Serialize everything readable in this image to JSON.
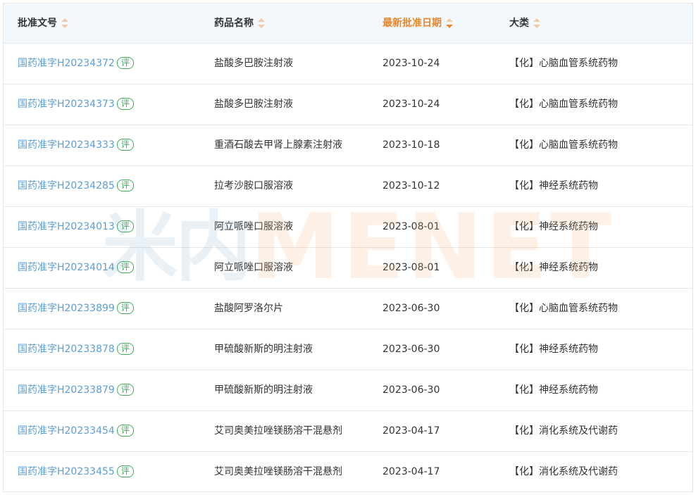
{
  "columns": [
    {
      "label": "批准文号",
      "sorted": false
    },
    {
      "label": "药品名称",
      "sorted": false
    },
    {
      "label": "最新批准日期",
      "sorted": true
    },
    {
      "label": "大类",
      "sorted": false
    }
  ],
  "badge_label": "评",
  "rows": [
    {
      "approval_no": "国药准字H20234372",
      "drug_name": "盐酸多巴胺注射液",
      "date": "2023-10-24",
      "category": "【化】心脑血管系统药物"
    },
    {
      "approval_no": "国药准字H20234373",
      "drug_name": "盐酸多巴胺注射液",
      "date": "2023-10-24",
      "category": "【化】心脑血管系统药物"
    },
    {
      "approval_no": "国药准字H20234333",
      "drug_name": "重酒石酸去甲肾上腺素注射液",
      "date": "2023-10-18",
      "category": "【化】心脑血管系统药物"
    },
    {
      "approval_no": "国药准字H20234285",
      "drug_name": "拉考沙胺口服溶液",
      "date": "2023-10-12",
      "category": "【化】神经系统药物"
    },
    {
      "approval_no": "国药准字H20234013",
      "drug_name": "阿立哌唑口服溶液",
      "date": "2023-08-01",
      "category": "【化】神经系统药物"
    },
    {
      "approval_no": "国药准字H20234014",
      "drug_name": "阿立哌唑口服溶液",
      "date": "2023-08-01",
      "category": "【化】神经系统药物"
    },
    {
      "approval_no": "国药准字H20233899",
      "drug_name": "盐酸阿罗洛尔片",
      "date": "2023-06-30",
      "category": "【化】心脑血管系统药物"
    },
    {
      "approval_no": "国药准字H20233878",
      "drug_name": "甲硫酸新斯的明注射液",
      "date": "2023-06-30",
      "category": "【化】神经系统药物"
    },
    {
      "approval_no": "国药准字H20233879",
      "drug_name": "甲硫酸新斯的明注射液",
      "date": "2023-06-30",
      "category": "【化】神经系统药物"
    },
    {
      "approval_no": "国药准字H20233454",
      "drug_name": "艾司奥美拉唑镁肠溶干混悬剂",
      "date": "2023-04-17",
      "category": "【化】消化系统及代谢药"
    },
    {
      "approval_no": "国药准字H20233455",
      "drug_name": "艾司奥美拉唑镁肠溶干混悬剂",
      "date": "2023-04-17",
      "category": "【化】消化系统及代谢药"
    }
  ],
  "watermark": {
    "cn": "米内",
    "en": "MENET"
  },
  "colors": {
    "link": "#5b9ed8",
    "badge": "#3fae5a",
    "sorted_header": "#e8862a",
    "header_bg": "#f3f8fd"
  }
}
